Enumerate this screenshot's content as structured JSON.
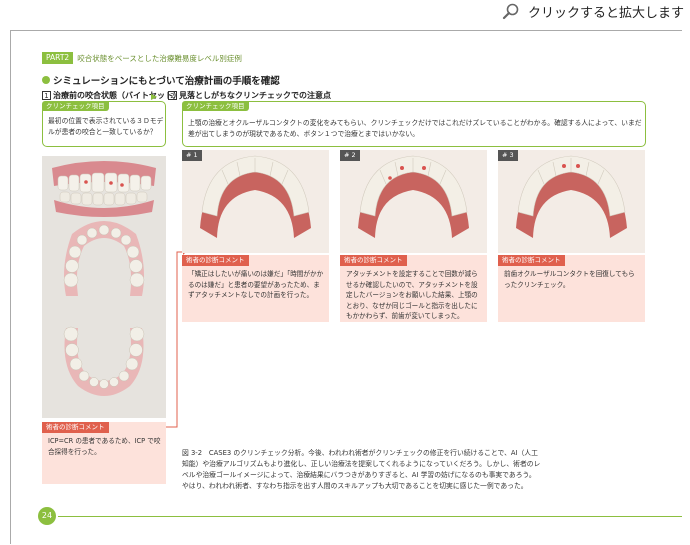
{
  "zoom": {
    "label": "クリックすると拡大します",
    "icon": "magnifier-icon"
  },
  "header": {
    "part_badge": "PART2",
    "part_title": "咬合状態をベースとした治療難易度レベル別症例"
  },
  "section_title": "シミュレーションにもとづいて治療計画の手順を確認",
  "steps": [
    {
      "num": "1",
      "label": "治療前の咬合状態（バイトセット）"
    },
    {
      "num": "2",
      "label": "見落としがちなクリンチェックでの注意点"
    }
  ],
  "check_left": {
    "tag": "クリンチェック項目",
    "text": "最初の位置で表示されている３Ｄモデルが患者の咬合と一致しているか？"
  },
  "check_right": {
    "tag": "クリンチェック項目",
    "text": "上顎の治療とオクルーザルコンタクトの変化をみてもらい、クリンチェックだけではこれだけズレていることがわかる。確認する人によって、いまだ差が出てしまうのが現状であるため、ボタン１つで治療とまではいかない。"
  },
  "cases": [
    {
      "label": "# 1",
      "comment_tag": "術者の診断コメント",
      "comment": "「矯正はしたいが痛いのは嫌だ」「時間がかかるのは嫌だ」と患者の要望があったため、まずアタッチメントなしでの計画を行った。"
    },
    {
      "label": "# 2",
      "comment_tag": "術者の診断コメント",
      "comment": "アタッチメントを設定することで回数が減らせるか確認したいので、アタッチメントを設定したバージョンをお願いした結果、上顎のとおり、なぜか同じゴールと指示を出したにもかかわらず、前歯が変いてしまった。"
    },
    {
      "label": "# 3",
      "comment_tag": "術者の診断コメント",
      "comment": "前歯オクルーザルコンタクトを回復してもらったクリンチェック。"
    }
  ],
  "left_comment": {
    "tag": "術者の診断コメント",
    "text": "ICP=CR の患者であるため、ICP で咬合採得を行った。"
  },
  "caption": "図 3-2　CASE3 のクリンチェック分析。今後、われわれ術者がクリンチェックの修正を行い続けることで、AI（人工知能）や治療アルゴリズムもより進化し、正しい治療法を提案してくれるようになっていくだろう。しかし、術者のレベルや治療ゴールイメージによって、治療結果にバラつきがありすぎると、AI 学習の妨げになるのも事実であろう。やはり、われわれ術者、すなわち指示を出す人間のスキルアップも大切であることを切実に感じた一例であった。",
  "page_number": "24",
  "colors": {
    "accent": "#8cbf3f",
    "comment_bg": "#fde2db",
    "comment_tag": "#e0604d"
  }
}
